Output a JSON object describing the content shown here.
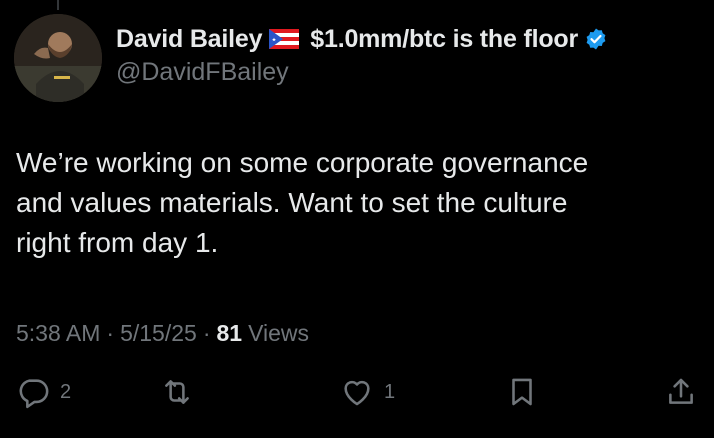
{
  "author": {
    "display_name": "David Bailey",
    "tagline": "$1.0mm/btc is the floor",
    "handle": "@DavidFBailey",
    "flag_icon": "puerto-rico-flag-icon",
    "verified_icon": "verified-badge-icon"
  },
  "tweet": {
    "lines": [
      "We’re working on some corporate governance",
      "and values materials. Want to set the culture",
      "right from day 1."
    ]
  },
  "meta": {
    "time": "5:38 AM",
    "separator": "·",
    "date": "5/15/25",
    "views_count": "81",
    "views_label": "Views"
  },
  "actions": {
    "reply_count": "2",
    "like_count": "1"
  },
  "colors": {
    "background": "#000000",
    "primary_text": "#e7e9ea",
    "secondary_text": "#71767b",
    "verified_blue": "#1d9bf0"
  }
}
